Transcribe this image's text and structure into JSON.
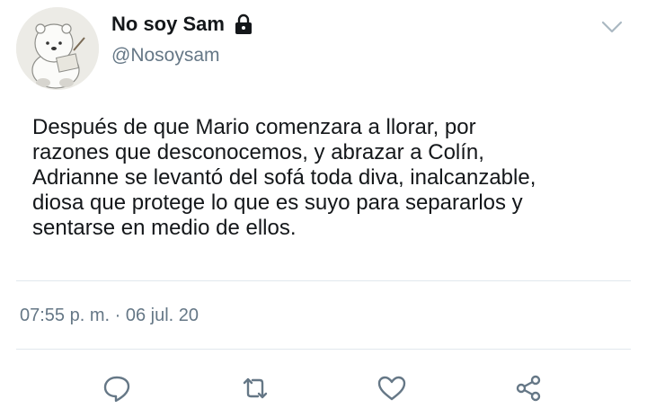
{
  "user": {
    "display_name": "No soy Sam",
    "handle": "@Nosoysam",
    "avatar_icon": "bear-avatar",
    "protected_icon": "lock-icon"
  },
  "tweet": {
    "lines": [
      "Después de que Mario comenzara a llorar, por",
      "razones que desconocemos, y abrazar a Colín,",
      "Adrianne se levantó del sofá toda diva, inalcanzable,",
      "diosa que protege lo que es suyo para separarlos y",
      "sentarse en medio de ellos."
    ],
    "timestamp": "07:55 p. m. · 06 jul. 20"
  },
  "actions": [
    "reply-icon",
    "retweet-icon",
    "like-icon",
    "share-icon"
  ],
  "colors": {
    "text": "#14171a",
    "secondary": "#657786",
    "icon": "#657786",
    "divider": "#e1e8ed"
  }
}
